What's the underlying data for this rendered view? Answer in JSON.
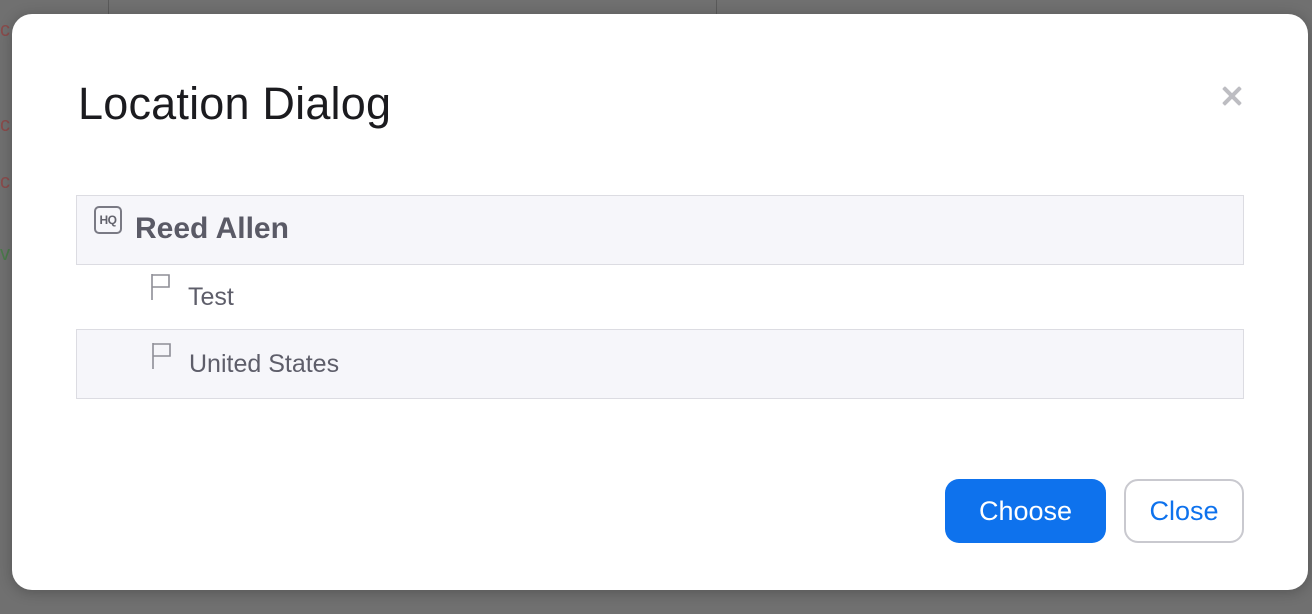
{
  "dialog": {
    "title": "Location Dialog",
    "close_icon": "close-icon"
  },
  "tree": {
    "root": {
      "badge": "HQ",
      "label": "Reed Allen",
      "icon": "hq-icon"
    },
    "children": [
      {
        "label": "Test",
        "icon": "flag-icon"
      },
      {
        "label": "United States",
        "icon": "flag-icon"
      }
    ]
  },
  "footer": {
    "choose_label": "Choose",
    "close_label": "Close"
  },
  "colors": {
    "primary": "#0e72ed",
    "row_background": "#f6f6fa",
    "row_border": "#dcdce2",
    "overlay": "#707070"
  }
}
